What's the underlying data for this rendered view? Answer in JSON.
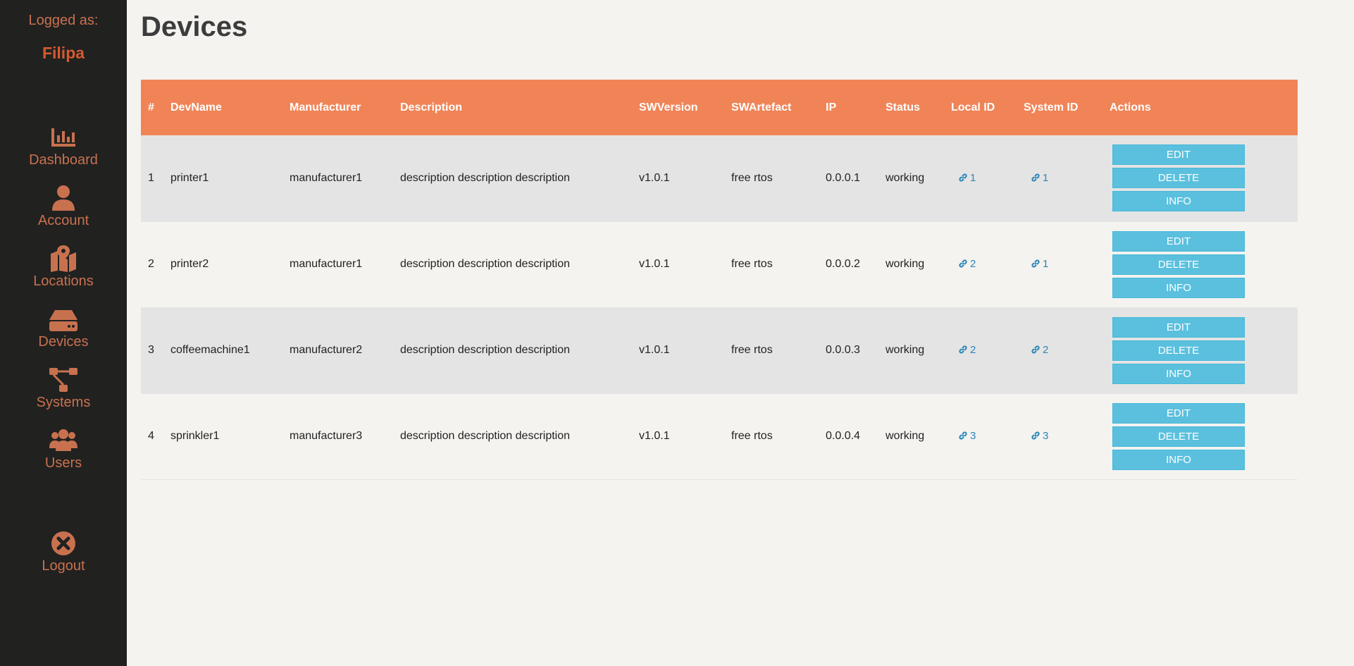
{
  "sidebar": {
    "logged_as_label": "Logged as:",
    "user_name": "Filipa",
    "items": [
      {
        "label": "Dashboard",
        "icon": "dashboard-chart-icon"
      },
      {
        "label": "Account",
        "icon": "user-icon"
      },
      {
        "label": "Locations",
        "icon": "map-marker-icon"
      },
      {
        "label": "Devices",
        "icon": "hdd-icon"
      },
      {
        "label": "Systems",
        "icon": "sitemap-icon"
      },
      {
        "label": "Users",
        "icon": "users-icon"
      }
    ],
    "logout": {
      "label": "Logout",
      "icon": "close-circle-icon"
    }
  },
  "main": {
    "title": "Devices",
    "columns": [
      "#",
      "DevName",
      "Manufacturer",
      "Description",
      "SWVersion",
      "SWArtefact",
      "IP",
      "Status",
      "Local ID",
      "System ID",
      "Actions"
    ],
    "rows": [
      {
        "num": "1",
        "devname": "printer1",
        "manufacturer": "manufacturer1",
        "description": "description description description",
        "swversion": "v1.0.1",
        "swartefact": "free rtos",
        "ip": "0.0.0.1",
        "status": "working",
        "local_id": "1",
        "system_id": "1"
      },
      {
        "num": "2",
        "devname": "printer2",
        "manufacturer": "manufacturer1",
        "description": "description description description",
        "swversion": "v1.0.1",
        "swartefact": "free rtos",
        "ip": "0.0.0.2",
        "status": "working",
        "local_id": "2",
        "system_id": "1"
      },
      {
        "num": "3",
        "devname": "coffeemachine1",
        "manufacturer": "manufacturer2",
        "description": "description description description",
        "swversion": "v1.0.1",
        "swartefact": "free rtos",
        "ip": "0.0.0.3",
        "status": "working",
        "local_id": "2",
        "system_id": "2"
      },
      {
        "num": "4",
        "devname": "sprinkler1",
        "manufacturer": "manufacturer3",
        "description": "description description description",
        "swversion": "v1.0.1",
        "swartefact": "free rtos",
        "ip": "0.0.0.4",
        "status": "working",
        "local_id": "3",
        "system_id": "3"
      }
    ],
    "actions": {
      "edit": "EDIT",
      "delete": "DELETE",
      "info": "INFO"
    }
  },
  "colors": {
    "sidebar_bg": "#212120",
    "accent": "#c8714f",
    "header_bg": "#f08457",
    "button_bg": "#5bc0de",
    "link": "#2a86b8"
  }
}
